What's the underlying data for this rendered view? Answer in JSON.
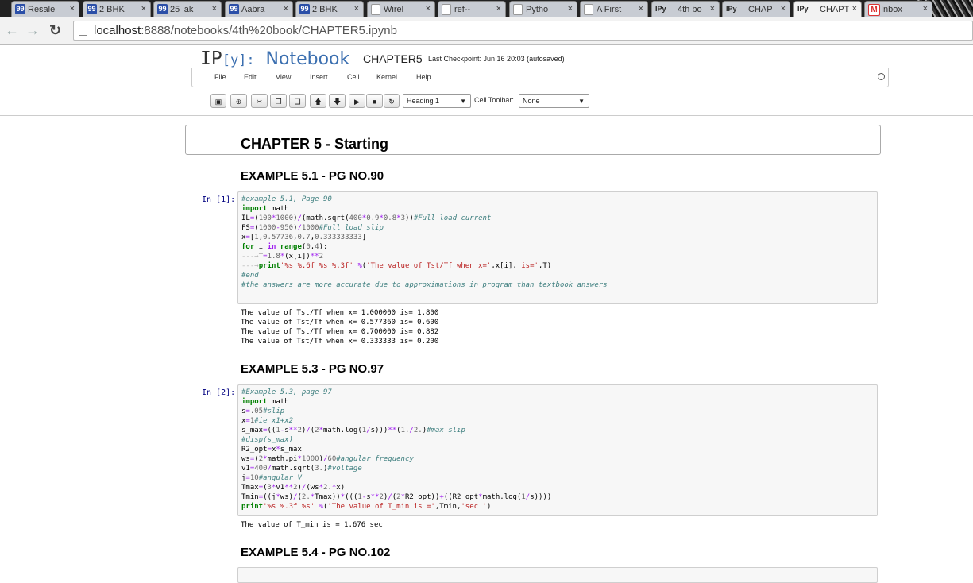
{
  "browser": {
    "tabs": [
      {
        "icon": "99",
        "title": "Resale"
      },
      {
        "icon": "99",
        "title": "2 BHK"
      },
      {
        "icon": "99",
        "title": "25 lak"
      },
      {
        "icon": "99",
        "title": "Aabra"
      },
      {
        "icon": "99",
        "title": "2 BHK"
      },
      {
        "icon": "doc",
        "title": "Wirel"
      },
      {
        "icon": "doc",
        "title": "ref--"
      },
      {
        "icon": "doc",
        "title": "Pytho"
      },
      {
        "icon": "doc",
        "title": "A First"
      },
      {
        "icon": "IPy",
        "title": "4th bo"
      },
      {
        "icon": "IPy",
        "title": "CHAP"
      },
      {
        "icon": "IPy",
        "title": "CHAPT"
      },
      {
        "icon": "M",
        "title": "Inbox"
      }
    ],
    "active_tab": 11,
    "url_host": "localhost",
    "url_path": ":8888/notebooks/4th%20book/CHAPTER5.ipynb",
    "close_glyph": "×"
  },
  "notebook": {
    "logo_ip": "IP",
    "logo_y": "[y]",
    "logo_colon": ":",
    "logo_notebook": "Notebook",
    "name": "CHAPTER5",
    "checkpoint": "Last Checkpoint: Jun 16 20:03 (autosaved)",
    "menus": [
      "File",
      "Edit",
      "View",
      "Insert",
      "Cell",
      "Kernel",
      "Help"
    ],
    "cell_type": "Heading 1",
    "cell_toolbar_label": "Cell Toolbar:",
    "cell_toolbar_value": "None"
  },
  "cells": {
    "chapter_title": "CHAPTER 5 - Starting",
    "ex1_heading": "EXAMPLE 5.1 - PG NO.90",
    "ex1_prompt": "In [1]:",
    "ex1_code": [
      "#example 5.1, Page 90",
      "import math",
      "IL=(100*1000)/(math.sqrt(400*0.9*0.8*3))#Full load current",
      "FS=(1000-950)/1000#Full load slip",
      "x=[1,0.57736,0.7,0.333333333]",
      "for i in range(0,4):",
      "    T=1.8*(x[i])**2",
      "    print'%s %.6f %s %.3f' %('The value of Tst/Tf when x=',x[i],'is=',T)",
      "#end",
      "#the answers are more accurate due to approximations in program than textbook answers"
    ],
    "ex1_output": [
      "The value of Tst/Tf when x= 1.000000 is= 1.800",
      "The value of Tst/Tf when x= 0.577360 is= 0.600",
      "The value of Tst/Tf when x= 0.700000 is= 0.882",
      "The value of Tst/Tf when x= 0.333333 is= 0.200"
    ],
    "ex3_heading": "EXAMPLE 5.3 - PG NO.97",
    "ex3_prompt": "In [2]:",
    "ex3_code": [
      "#Example 5.3, page 97",
      "import math",
      "s=.05#slip",
      "x=1#ie x1+x2",
      "s_max=((1-s**2)/(2*math.log(1/s)))**(1./2.)#max slip",
      "#disp(s_max)",
      "R2_opt=x*s_max",
      "ws=(2*math.pi*1000)/60#angular frequency",
      "v1=400/math.sqrt(3.)#voltage",
      "j=10#angular V",
      "Tmax=(3*v1**2)/(ws*2.*x)",
      "Tmin=((j*ws)/(2.*Tmax))*(((1-s**2)/(2*R2_opt))+((R2_opt*math.log(1/s))))",
      "print'%s %.3f %s' %('The value of T_min is =',Tmin,'sec ')"
    ],
    "ex3_output": [
      "The value of T_min is = 1.676 sec"
    ],
    "ex4_heading": "EXAMPLE 5.4 - PG NO.102"
  }
}
